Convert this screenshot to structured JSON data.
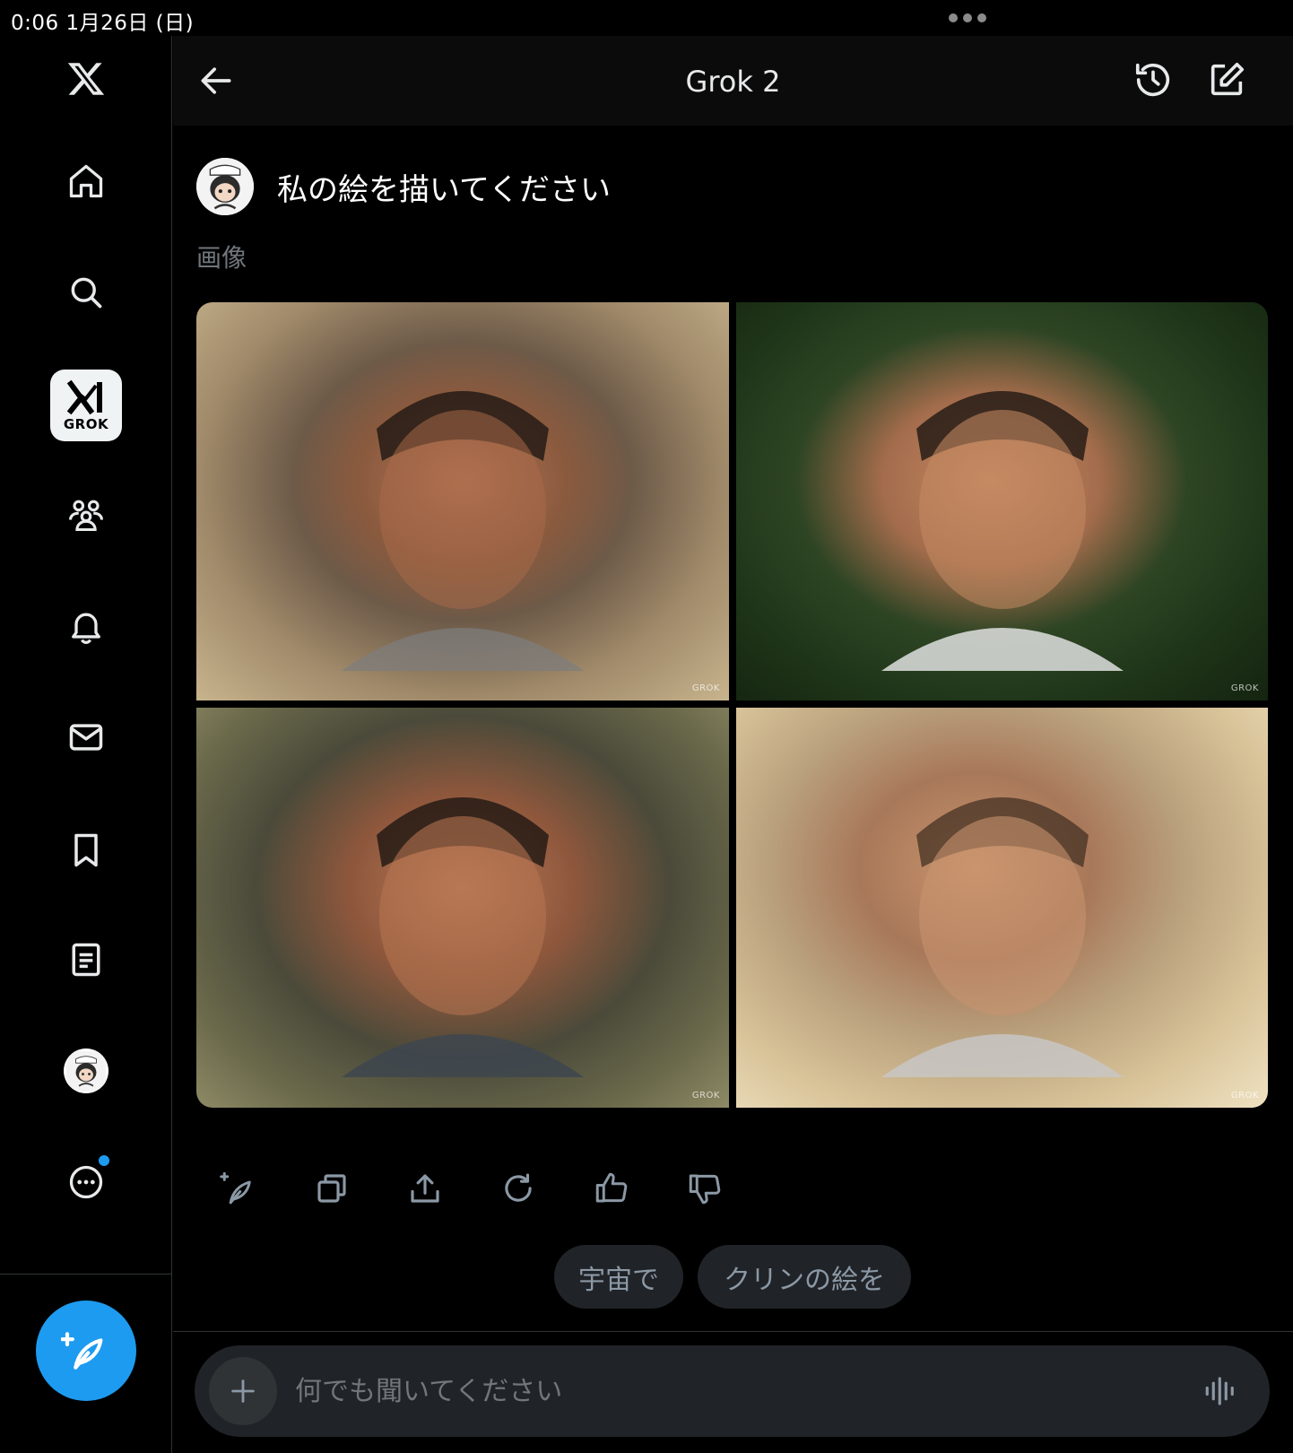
{
  "status_bar": {
    "datetime": "0:06   1月26日 (日)"
  },
  "header": {
    "title": "Grok 2"
  },
  "sidebar": {
    "items": [
      {
        "name": "home"
      },
      {
        "name": "search"
      },
      {
        "name": "grok",
        "label": "GROK"
      },
      {
        "name": "communities"
      },
      {
        "name": "notifications"
      },
      {
        "name": "messages"
      },
      {
        "name": "bookmarks"
      },
      {
        "name": "lists"
      },
      {
        "name": "profile"
      },
      {
        "name": "more"
      }
    ]
  },
  "conversation": {
    "user_message": "私の絵を描いてください",
    "section_label": "画像",
    "images": [
      {
        "watermark": "GROK"
      },
      {
        "watermark": "GROK"
      },
      {
        "watermark": "GROK"
      },
      {
        "watermark": "GROK"
      }
    ]
  },
  "suggestions": [
    "宇宙で",
    "クリンの絵を"
  ],
  "composer": {
    "placeholder": "何でも聞いてください"
  },
  "colors": {
    "accent": "#1d9bf0",
    "background": "#000000",
    "chip": "#202327"
  }
}
